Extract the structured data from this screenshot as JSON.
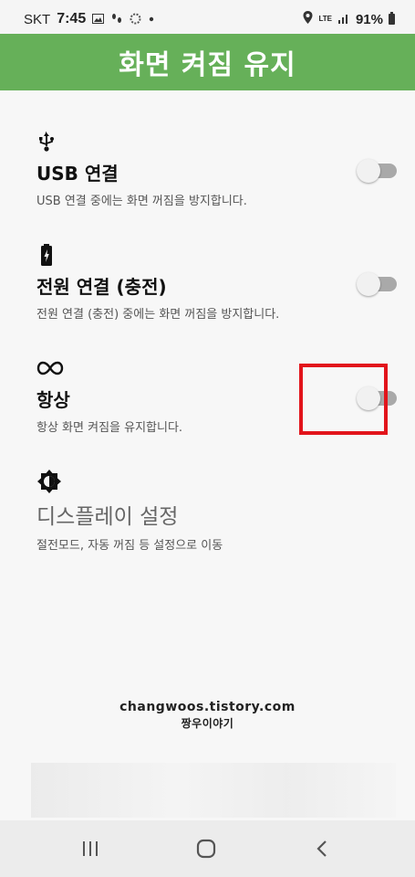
{
  "status_bar": {
    "carrier": "SKT",
    "time": "7:45",
    "network": "LTE",
    "battery": "91%"
  },
  "app": {
    "title": "화면 켜짐 유지"
  },
  "settings": [
    {
      "icon": "usb-icon",
      "title": "USB 연결",
      "description": "USB 연결 중에는 화면 꺼짐을 방지합니다.",
      "enabled": false
    },
    {
      "icon": "battery-charging-icon",
      "title": "전원 연결 (충전)",
      "description": "전원 연결 (충전) 중에는 화면 꺼짐을 방지합니다.",
      "enabled": false
    },
    {
      "icon": "infinity-icon",
      "title": "항상",
      "description": "항상 화면 켜짐을 유지합니다.",
      "enabled": false
    }
  ],
  "display_link": {
    "icon": "brightness-icon",
    "title": "디스플레이 설정",
    "description": "절전모드, 자동 꺼짐 등 설정으로 이동"
  },
  "watermark": {
    "line1": "changwoos.tistory.com",
    "line2": "짱우이야기"
  },
  "nav": {
    "recent": "recent-apps-icon",
    "home": "home-icon",
    "back": "back-icon"
  },
  "colors": {
    "app_bar": "#66b059",
    "highlight": "#e2141b"
  }
}
